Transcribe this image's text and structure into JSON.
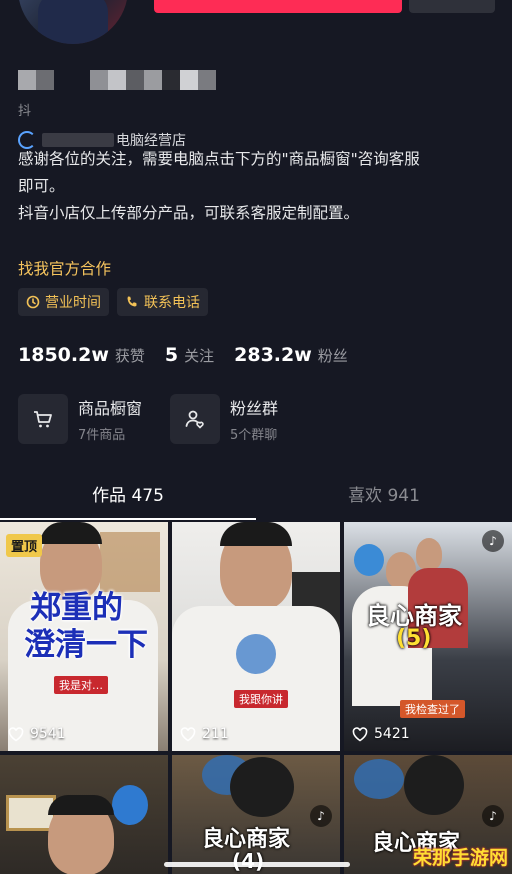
{
  "profile": {
    "douyin_id_prefix": "抖",
    "shop_name_suffix": "电脑经营店",
    "bio_lines": [
      "感谢各位的关注，需要电脑点击下方的\"商品橱窗\"咨询客服",
      "即可。",
      "抖音小店仅上传部分产品，可联系客服定制配置。"
    ],
    "official_link": "找我官方合作",
    "chips": [
      {
        "label": "营业时间",
        "icon": "clock-icon"
      },
      {
        "label": "联系电话",
        "icon": "phone-icon"
      }
    ]
  },
  "stats": [
    {
      "value": "1850.2w",
      "label": "获赞"
    },
    {
      "value": "5",
      "label": "关注"
    },
    {
      "value": "283.2w",
      "label": "粉丝"
    }
  ],
  "entries": [
    {
      "title": "商品橱窗",
      "sub": "7件商品",
      "icon": "cart-icon"
    },
    {
      "title": "粉丝群",
      "sub": "5个群聊",
      "icon": "group-icon"
    }
  ],
  "tabs": [
    {
      "label": "作品 475",
      "active": true
    },
    {
      "label": "喜欢 941",
      "active": false
    }
  ],
  "videos": [
    {
      "pinned": "置顶",
      "caption": [
        "郑重的",
        "澄清一下"
      ],
      "subtitle": "我是对…",
      "likes": "9541"
    },
    {
      "caption": [],
      "subtitle": "我跟你讲",
      "likes": "211"
    },
    {
      "caption": [
        "良心商家",
        "(5)"
      ],
      "subtitle": "我检查过了",
      "likes": "5421"
    },
    {
      "caption": [],
      "likes": ""
    },
    {
      "caption": [
        "良心商家",
        "(4)"
      ],
      "likes": ""
    },
    {
      "caption": [
        "良心商家"
      ],
      "likes": ""
    }
  ],
  "watermark": "荣那手游网",
  "colors": {
    "background": "#161823",
    "accent_red": "#fe2c55",
    "gold": "#f3c257"
  }
}
